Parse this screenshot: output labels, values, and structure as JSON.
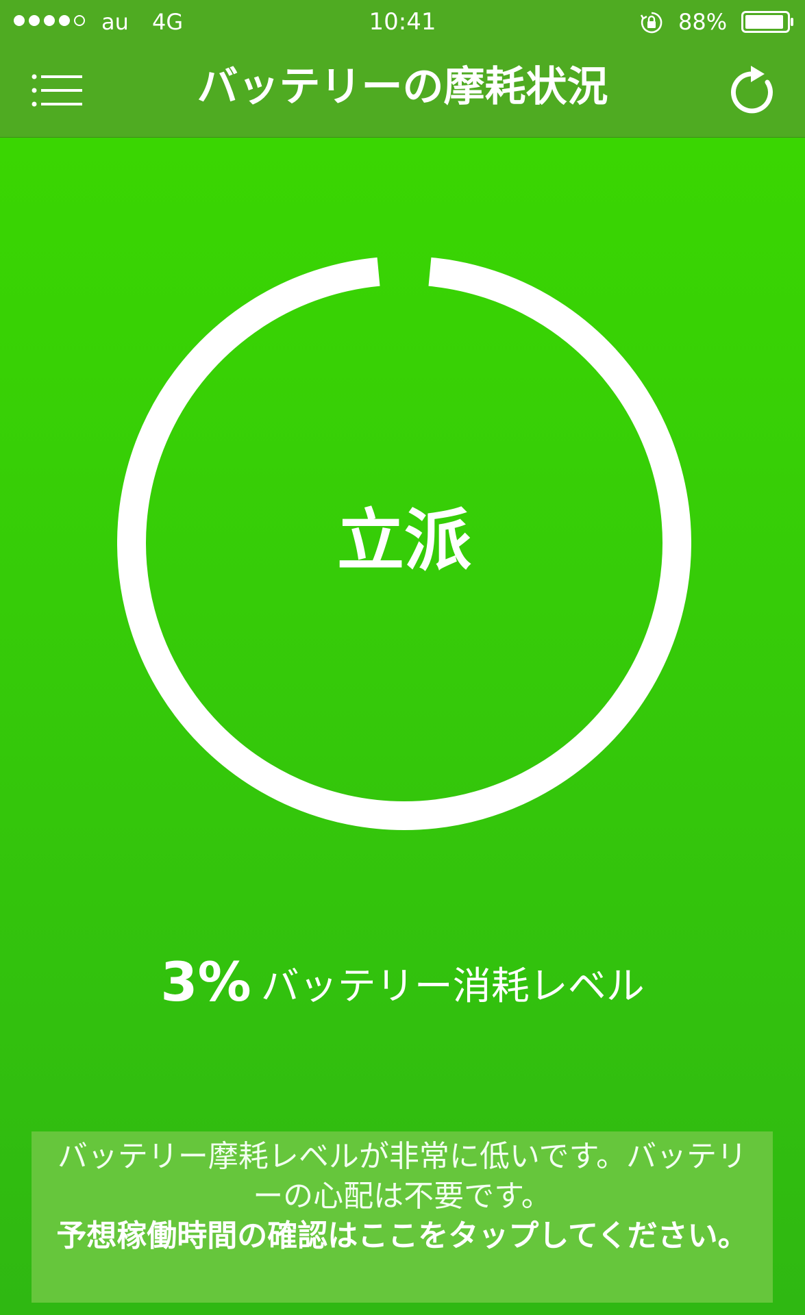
{
  "status_bar": {
    "carrier": "au",
    "network": "4G",
    "time": "10:41",
    "battery": "88%",
    "signal_bars_filled": 4,
    "signal_bars_total": 5,
    "icons": [
      "orientation-lock-icon",
      "battery-icon"
    ]
  },
  "nav": {
    "title": "バッテリーの摩耗状況",
    "left_icon": "menu-icon",
    "right_icon": "refresh-icon"
  },
  "gauge": {
    "label": "立派",
    "wear_percent": 3
  },
  "wear": {
    "value": "3%",
    "label": "バッテリー消耗レベル"
  },
  "info": {
    "message": "バッテリー摩耗レベルが非常に低いです。バッテリーの心配は不要です。",
    "link": "予想稼働時間の確認はここをタップしてください。"
  },
  "colors": {
    "background": "#36cc08",
    "bar": "#4fab22",
    "info_box": "#66c63c",
    "ring": "#ffffff"
  }
}
